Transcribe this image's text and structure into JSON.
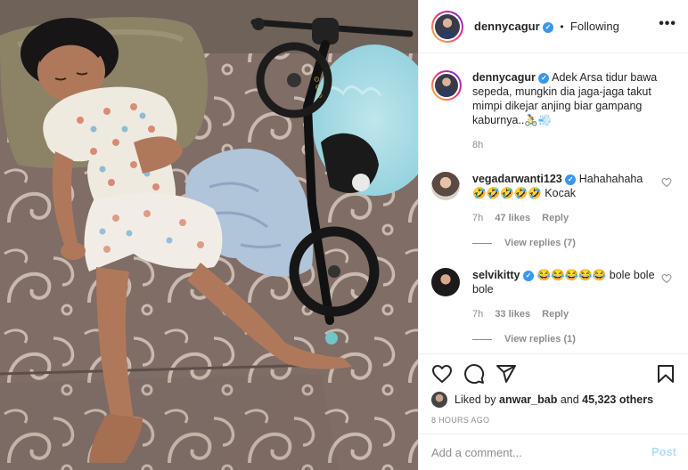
{
  "header": {
    "username": "dennycagur",
    "verified_mark": "✓",
    "dot": "•",
    "follow_status": "Following",
    "more_label": "•••"
  },
  "caption": {
    "username": "dennycagur",
    "text": "Adek Arsa tidur bawa sepeda, mungkin dia jaga-jaga takut mimpi dikejar anjing biar gampang kaburnya..🚴🏻💨",
    "time": "8h"
  },
  "comments": [
    {
      "username": "vegadarwanti123",
      "text": "Hahahahaha 🤣🤣🤣🤣🤣 Kocak",
      "time": "7h",
      "likes": "47 likes",
      "reply_label": "Reply",
      "view_replies": "View replies (7)"
    },
    {
      "username": "selvikitty",
      "text": "😂😂😂😂😂 bole bole bole",
      "time": "7h",
      "likes": "33 likes",
      "reply_label": "Reply",
      "view_replies": "View replies (1)"
    }
  ],
  "likes": {
    "prefix": "Liked by ",
    "user": "anwar_bab",
    "middle": " and ",
    "count": "45,323 others"
  },
  "posted_ago": "8 HOURS AGO",
  "comment_box": {
    "placeholder": "Add a comment...",
    "post_label": "Post"
  },
  "icons": {
    "like": "heart-icon",
    "comment": "comment-bubble-icon",
    "share": "paper-plane-icon",
    "save": "bookmark-icon"
  },
  "colors": {
    "verified_blue": "#3897f0",
    "muted_text": "#8e8e8e",
    "post_disabled": "#b2dffc",
    "border": "#efefef"
  }
}
